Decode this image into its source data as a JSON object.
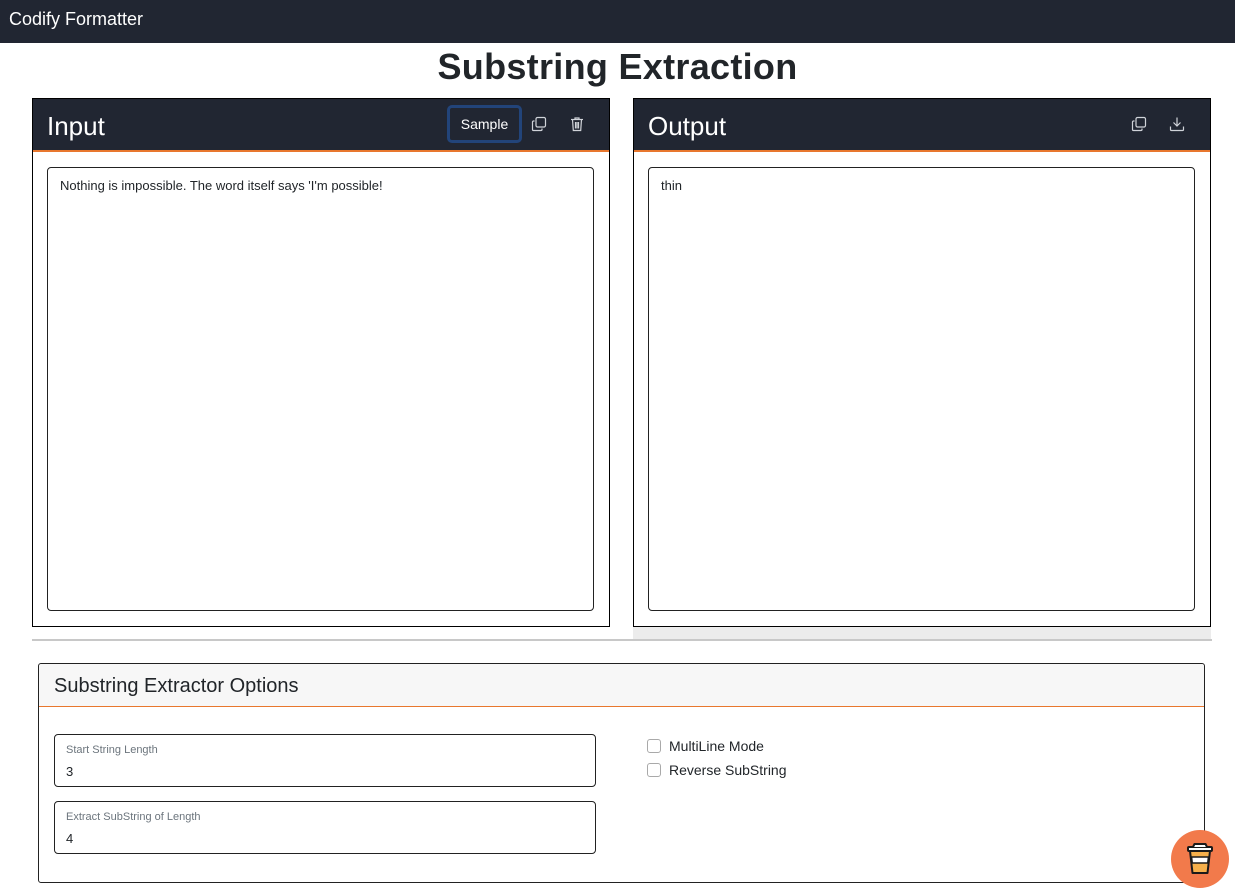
{
  "navbar": {
    "brand": "Codify Formatter"
  },
  "page": {
    "title": "Substring Extraction"
  },
  "input_panel": {
    "title": "Input",
    "sample_label": "Sample",
    "text": "Nothing is impossible. The word itself says 'I'm possible!",
    "icons": [
      "copy-icon",
      "trash-icon"
    ]
  },
  "output_panel": {
    "title": "Output",
    "text": "thin",
    "icons": [
      "copy-icon",
      "download-icon"
    ]
  },
  "options": {
    "title": "Substring Extractor Options",
    "start_length": {
      "label": "Start String Length",
      "value": "3"
    },
    "extract_length": {
      "label": "Extract SubString of Length",
      "value": "4"
    },
    "multiline": {
      "label": "MultiLine Mode",
      "checked": false
    },
    "reverse": {
      "label": "Reverse SubString",
      "checked": false
    }
  },
  "fab": {
    "icon": "coffee-cup-icon"
  },
  "colors": {
    "dark": "#212632",
    "accent": "#e8772e",
    "fab": "#f27a4b",
    "sample_border": "#22447a"
  }
}
